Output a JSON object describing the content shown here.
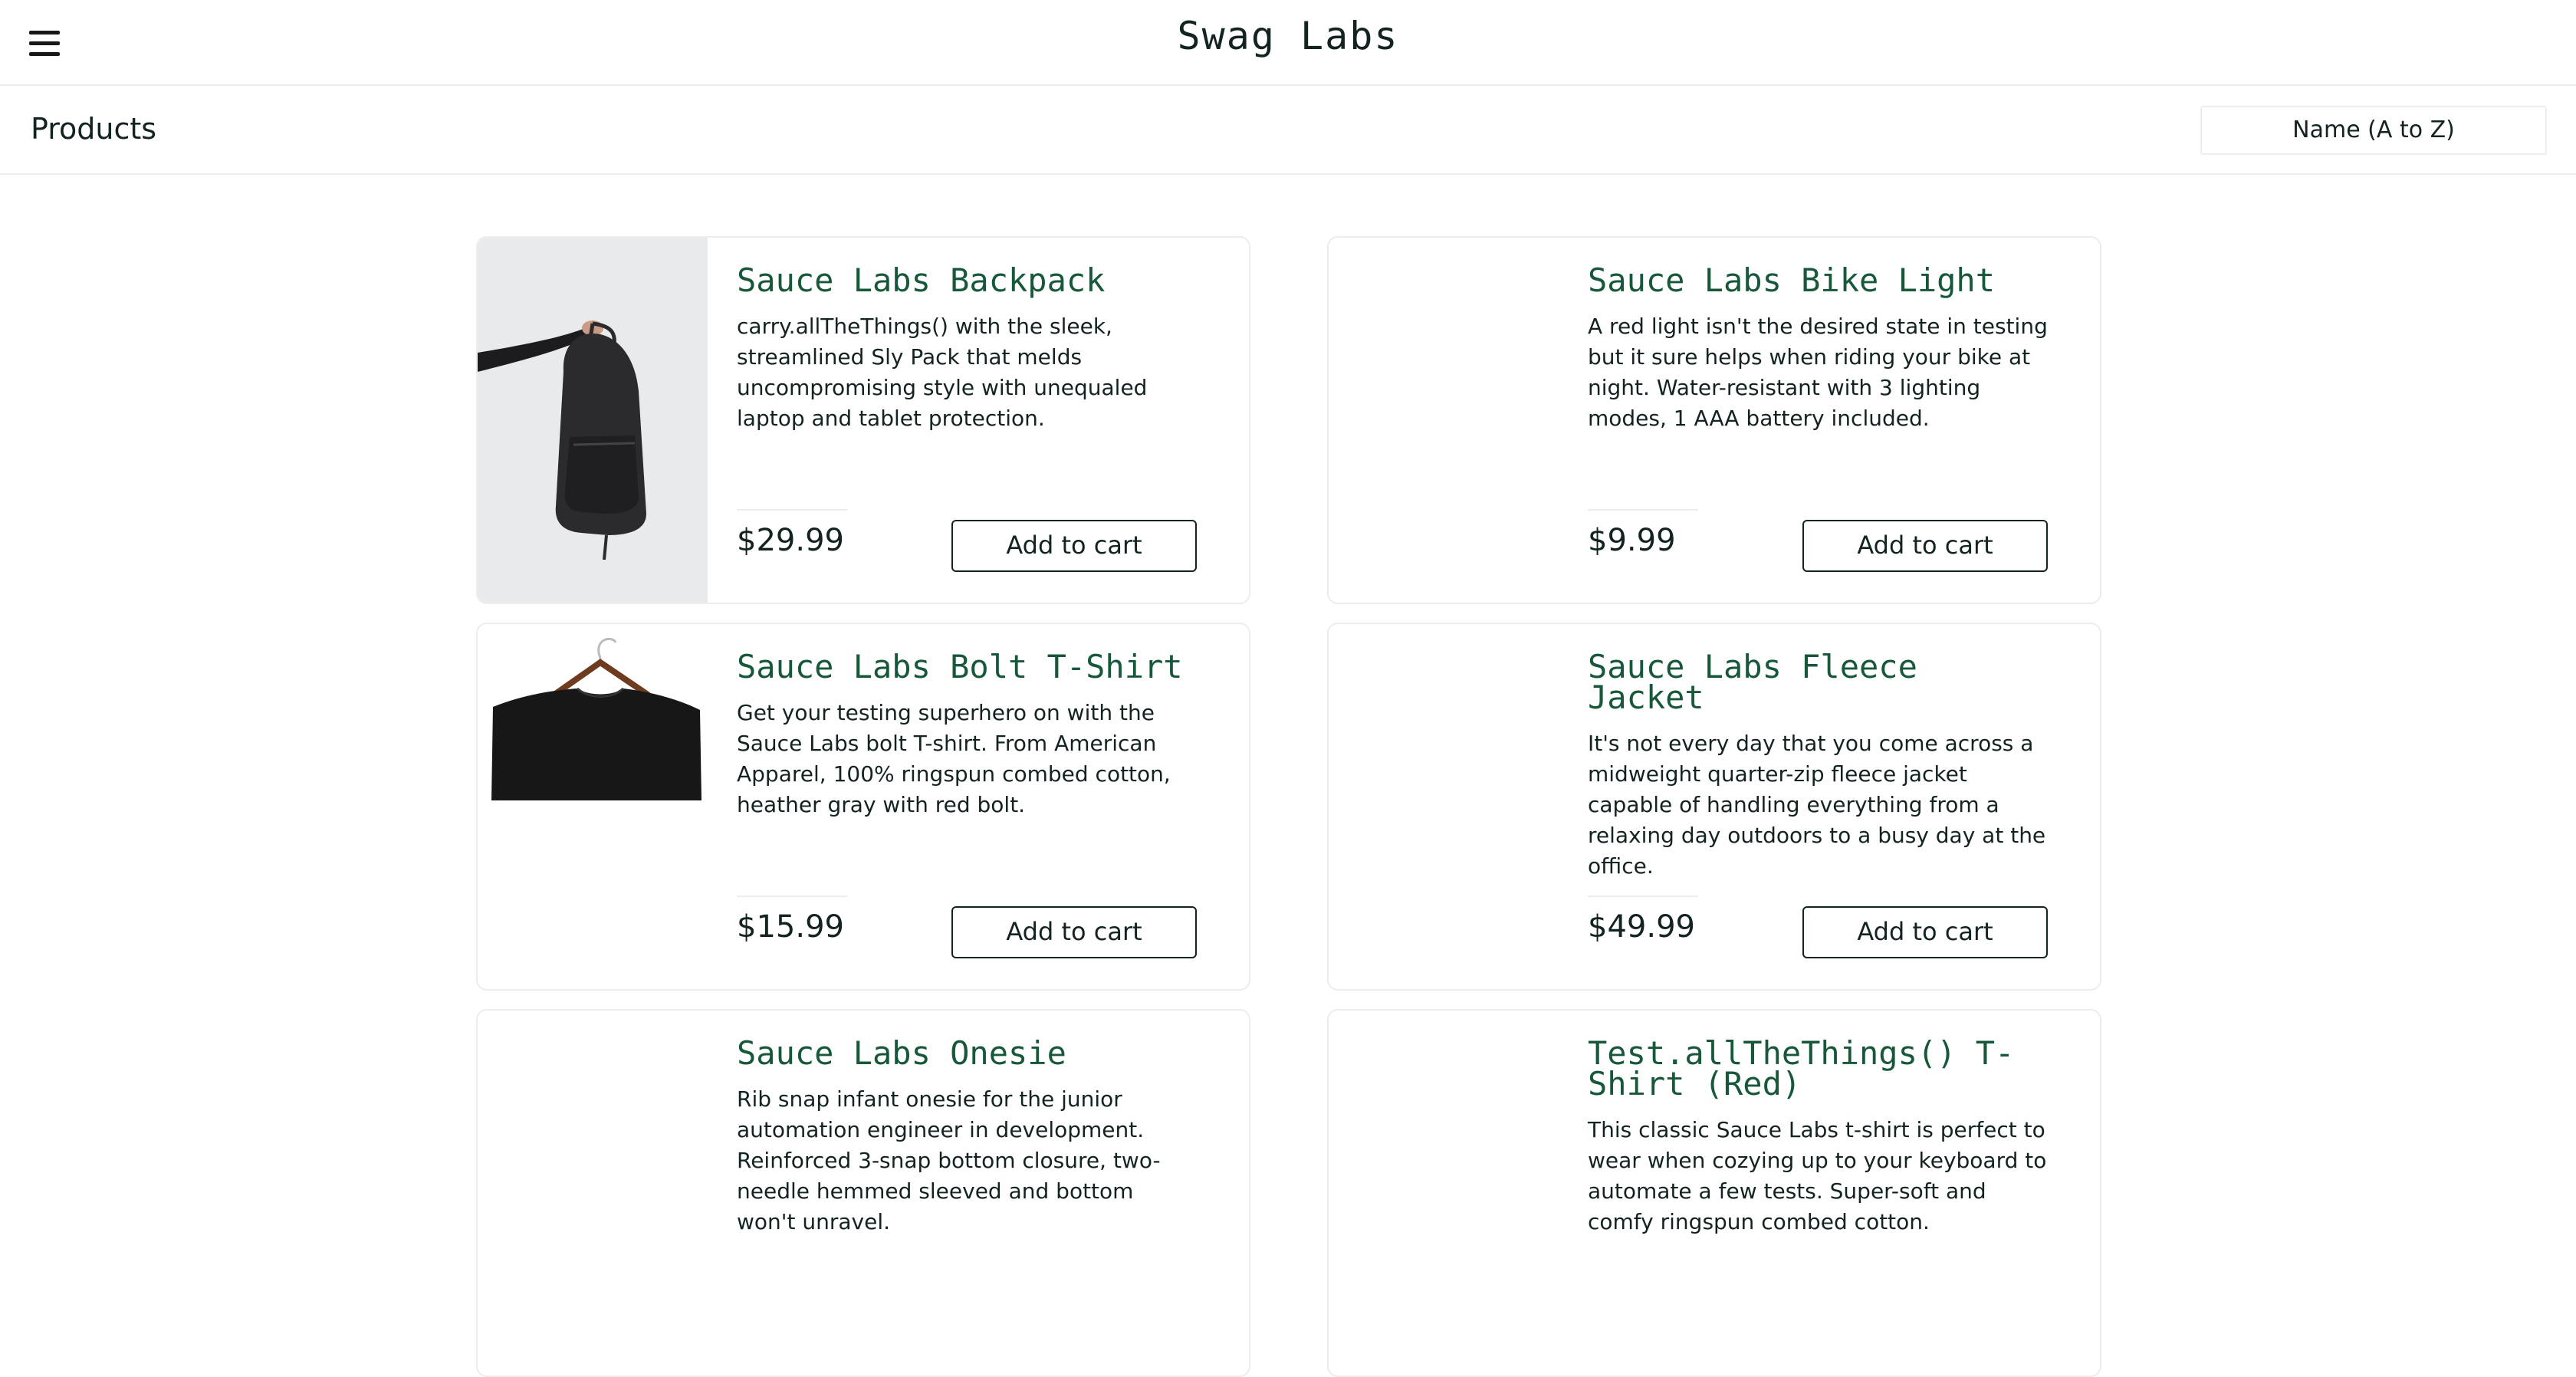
{
  "header": {
    "title": "Swag Labs",
    "menu_icon": "hamburger-menu-icon"
  },
  "subheader": {
    "title": "Products",
    "sort_selected": "Name (A to Z)"
  },
  "products": [
    {
      "name": "Sauce Labs Backpack",
      "desc": "carry.allTheThings() with the sleek, streamlined Sly Pack that melds uncompromising style with unequaled laptop and tablet protection.",
      "price": "$29.99",
      "button": "Add to cart"
    },
    {
      "name": "Sauce Labs Bike Light",
      "desc": "A red light isn't the desired state in testing but it sure helps when riding your bike at night. Water-resistant with 3 lighting modes, 1 AAA battery included.",
      "price": "$9.99",
      "button": "Add to cart"
    },
    {
      "name": "Sauce Labs Bolt T-Shirt",
      "desc": "Get your testing superhero on with the Sauce Labs bolt T-shirt. From American Apparel, 100% ringspun combed cotton, heather gray with red bolt.",
      "price": "$15.99",
      "button": "Add to cart"
    },
    {
      "name": "Sauce Labs Fleece Jacket",
      "desc": "It's not every day that you come across a midweight quarter-zip fleece jacket capable of handling everything from a relaxing day outdoors to a busy day at the office.",
      "price": "$49.99",
      "button": "Add to cart"
    },
    {
      "name": "Sauce Labs Onesie",
      "desc": "Rib snap infant onesie for the junior automation engineer in development. Reinforced 3-snap bottom closure, two-needle hemmed sleeved and bottom won't unravel."
    },
    {
      "name": "Test.allTheThings() T-Shirt (Red)",
      "desc": "This classic Sauce Labs t-shirt is perfect to wear when cozying up to your keyboard to automate a few tests. Super-soft and comfy ringspun combed cotton."
    }
  ],
  "colors": {
    "product_name": "#18583a",
    "text": "#132322",
    "border": "#ededed"
  }
}
